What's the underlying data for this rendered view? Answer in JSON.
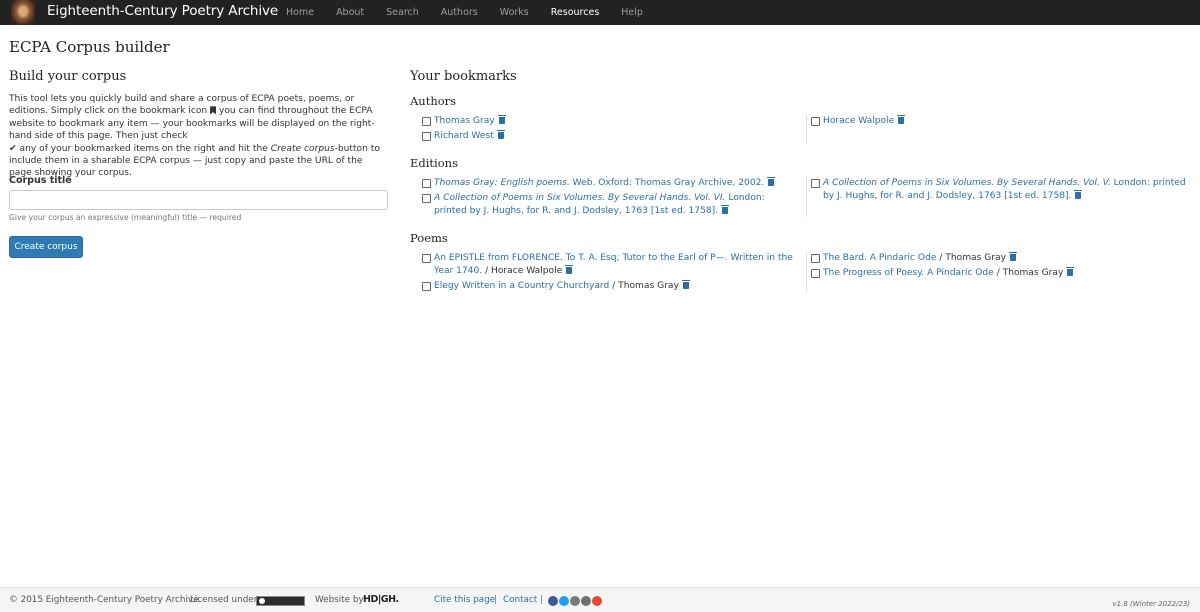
{
  "nav": {
    "brand": "Eighteenth-Century Poetry Archive",
    "links": [
      {
        "label": "Home"
      },
      {
        "label": "About"
      },
      {
        "label": "Search"
      },
      {
        "label": "Authors"
      },
      {
        "label": "Works"
      },
      {
        "label": "Resources"
      },
      {
        "label": "Help"
      }
    ],
    "active": "Resources"
  },
  "page": {
    "title": "ECPA Corpus builder"
  },
  "builder": {
    "heading": "Build your corpus",
    "intro_1": "This tool lets you quickly build and share a corpus of ECPA poets, poems, or editions. Simply click on the bookmark icon",
    "intro_2": "you can find throughout the ECPA website to bookmark any item — your bookmarks will be displayed on the right-hand side of this page. Then just check",
    "intro_check": "✔",
    "intro_3": "any of your bookmarked items on the right and hit the",
    "intro_em": "Create corpus",
    "intro_4": "-button to include them in a sharable ECPA corpus — just copy and paste the URL of the page showing your corpus.",
    "label": "Corpus title",
    "input_value": "",
    "input_placeholder": "",
    "help": "Give your corpus an expressive (meaningful) title — required",
    "button": "Create corpus"
  },
  "bookmarks": {
    "heading": "Your bookmarks",
    "authors": {
      "heading": "Authors",
      "left": [
        {
          "name": "Thomas Gray"
        },
        {
          "name": "Richard West"
        }
      ],
      "right": [
        {
          "name": "Horace Walpole"
        }
      ]
    },
    "editions": {
      "heading": "Editions",
      "left": [
        {
          "title": "Thomas Gray: English poems.",
          "rest": " Web. Oxford: Thomas Gray Archive, 2002."
        },
        {
          "title": "A Collection of Poems in Six Volumes. By Several Hands. Vol. VI.",
          "rest": " London: printed by J. Hughs, for R. and J. Dodsley, 1763 [1st ed. 1758]."
        }
      ],
      "right": [
        {
          "title": "A Collection of Poems in Six Volumes. By Several Hands. Vol. V.",
          "rest": " London: printed by J. Hughs, for R. and J. Dodsley, 1763 [1st ed. 1758]."
        }
      ]
    },
    "poems": {
      "heading": "Poems",
      "left": [
        {
          "title": "An EPISTLE from FLORENCE. To T. A. Esq; Tutor to the Earl of P—. Written in the Year 1740.",
          "author": " / Horace Walpole"
        },
        {
          "title": "Elegy Written in a Country Churchyard",
          "author": " / Thomas Gray"
        }
      ],
      "right": [
        {
          "title": "The Bard. A Pindaric Ode",
          "author": " / Thomas Gray"
        },
        {
          "title": "The Progress of Poesy. A Pindaric Ode",
          "author": " / Thomas Gray"
        }
      ]
    }
  },
  "footer": {
    "copyright": "© 2015 Eighteenth-Century Poetry Archive.",
    "licensed": "Licensed under",
    "website_by": "Website by",
    "hdigh": "HD|GH.",
    "cite": "Cite this page",
    "sep": "|",
    "contact": "Contact",
    "version": "v1.8 (Winter 2022/23)",
    "social_colors": [
      "#3b5998",
      "#1da1f2",
      "#7a7a7a",
      "#6f6f6f",
      "#e04a39"
    ]
  }
}
